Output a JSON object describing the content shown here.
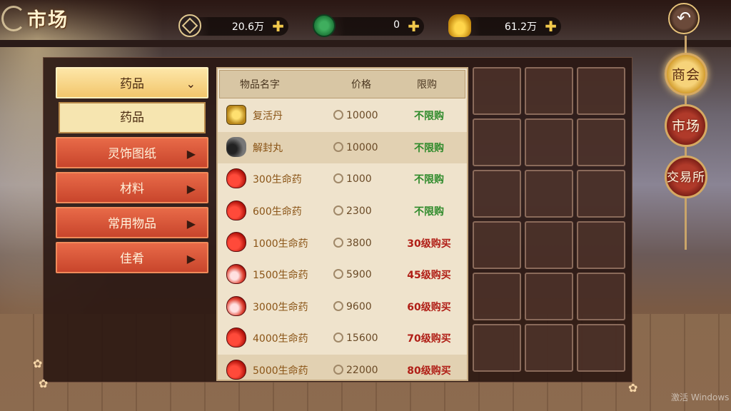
{
  "header": {
    "title": "市场",
    "currencies": [
      {
        "icon": "copper-coin-icon",
        "value": "20.6万"
      },
      {
        "icon": "jade-coin-icon",
        "value": "0"
      },
      {
        "icon": "gold-ingot-icon",
        "value": "61.2万"
      }
    ]
  },
  "side_nav": {
    "items": [
      {
        "label": "商会",
        "active": true
      },
      {
        "label": "市场",
        "active": false
      },
      {
        "label": "交易所",
        "active": false
      }
    ]
  },
  "categories": {
    "selected": "药品",
    "sub_selected": "药品",
    "others": [
      "灵饰图纸",
      "材料",
      "常用物品",
      "佳肴"
    ]
  },
  "list": {
    "headers": {
      "name": "物品名字",
      "price": "价格",
      "limit": "限购"
    },
    "rows": [
      {
        "icon": "revive-pill-icon",
        "name": "复活丹",
        "price": "10000",
        "limit": "不限购",
        "limited": false
      },
      {
        "icon": "unseal-pill-icon",
        "name": "解封丸",
        "price": "10000",
        "limit": "不限购",
        "limited": false
      },
      {
        "icon": "health-potion-icon",
        "name": "300生命药",
        "price": "1000",
        "limit": "不限购",
        "limited": false
      },
      {
        "icon": "health-potion-icon",
        "name": "600生命药",
        "price": "2300",
        "limit": "不限购",
        "limited": false
      },
      {
        "icon": "health-potion-icon",
        "name": "1000生命药",
        "price": "3800",
        "limit": "30级购买",
        "limited": true
      },
      {
        "icon": "health-potion-icon",
        "name": "1500生命药",
        "price": "5900",
        "limit": "45级购买",
        "limited": true
      },
      {
        "icon": "health-potion-icon",
        "name": "3000生命药",
        "price": "9600",
        "limit": "60级购买",
        "limited": true
      },
      {
        "icon": "health-potion-icon",
        "name": "4000生命药",
        "price": "15600",
        "limit": "70级购买",
        "limited": true
      },
      {
        "icon": "health-potion-icon",
        "name": "5000生命药",
        "price": "22000",
        "limit": "80级购买",
        "limited": true
      }
    ]
  },
  "watermark": "激活 Windows"
}
